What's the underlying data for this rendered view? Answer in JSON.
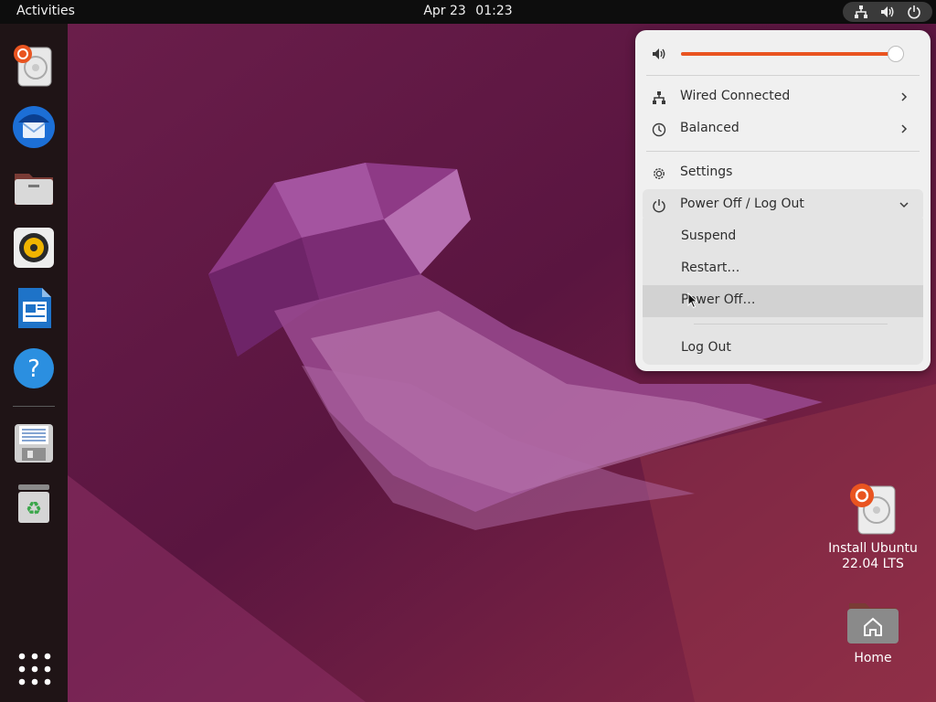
{
  "topbar": {
    "activities": "Activities",
    "date": "Apr 23",
    "time": "01:23"
  },
  "tray_icons": [
    "network-wired-icon",
    "volume-icon",
    "power-icon"
  ],
  "dock": {
    "apps": [
      {
        "name": "Install Ubuntu",
        "icon": "ubuntu-installer-icon"
      },
      {
        "name": "Thunderbird Mail",
        "icon": "thunderbird-icon"
      },
      {
        "name": "Files",
        "icon": "files-icon"
      },
      {
        "name": "Rhythmbox",
        "icon": "rhythmbox-icon"
      },
      {
        "name": "LibreOffice Writer",
        "icon": "writer-icon"
      },
      {
        "name": "Help",
        "icon": "help-icon"
      },
      {
        "name": "Floppy drive",
        "icon": "floppy-icon"
      },
      {
        "name": "Trash",
        "icon": "trash-icon"
      }
    ],
    "show_apps_icon": "apps-grid-icon"
  },
  "desktop": {
    "icons": [
      {
        "label_line1": "Install Ubuntu",
        "label_line2": "22.04 LTS",
        "icon": "ubuntu-installer-icon"
      },
      {
        "label_line1": "Home",
        "icon": "home-folder-icon"
      }
    ]
  },
  "quick_settings": {
    "volume_level": 0.96,
    "accent_color": "#e95420",
    "network_label": "Wired Connected",
    "power_mode_label": "Balanced",
    "settings_label": "Settings",
    "power_menu_label": "Power Off / Log Out",
    "power_submenu": {
      "suspend": "Suspend",
      "restart": "Restart…",
      "power_off": "Power Off…",
      "log_out": "Log Out"
    }
  }
}
